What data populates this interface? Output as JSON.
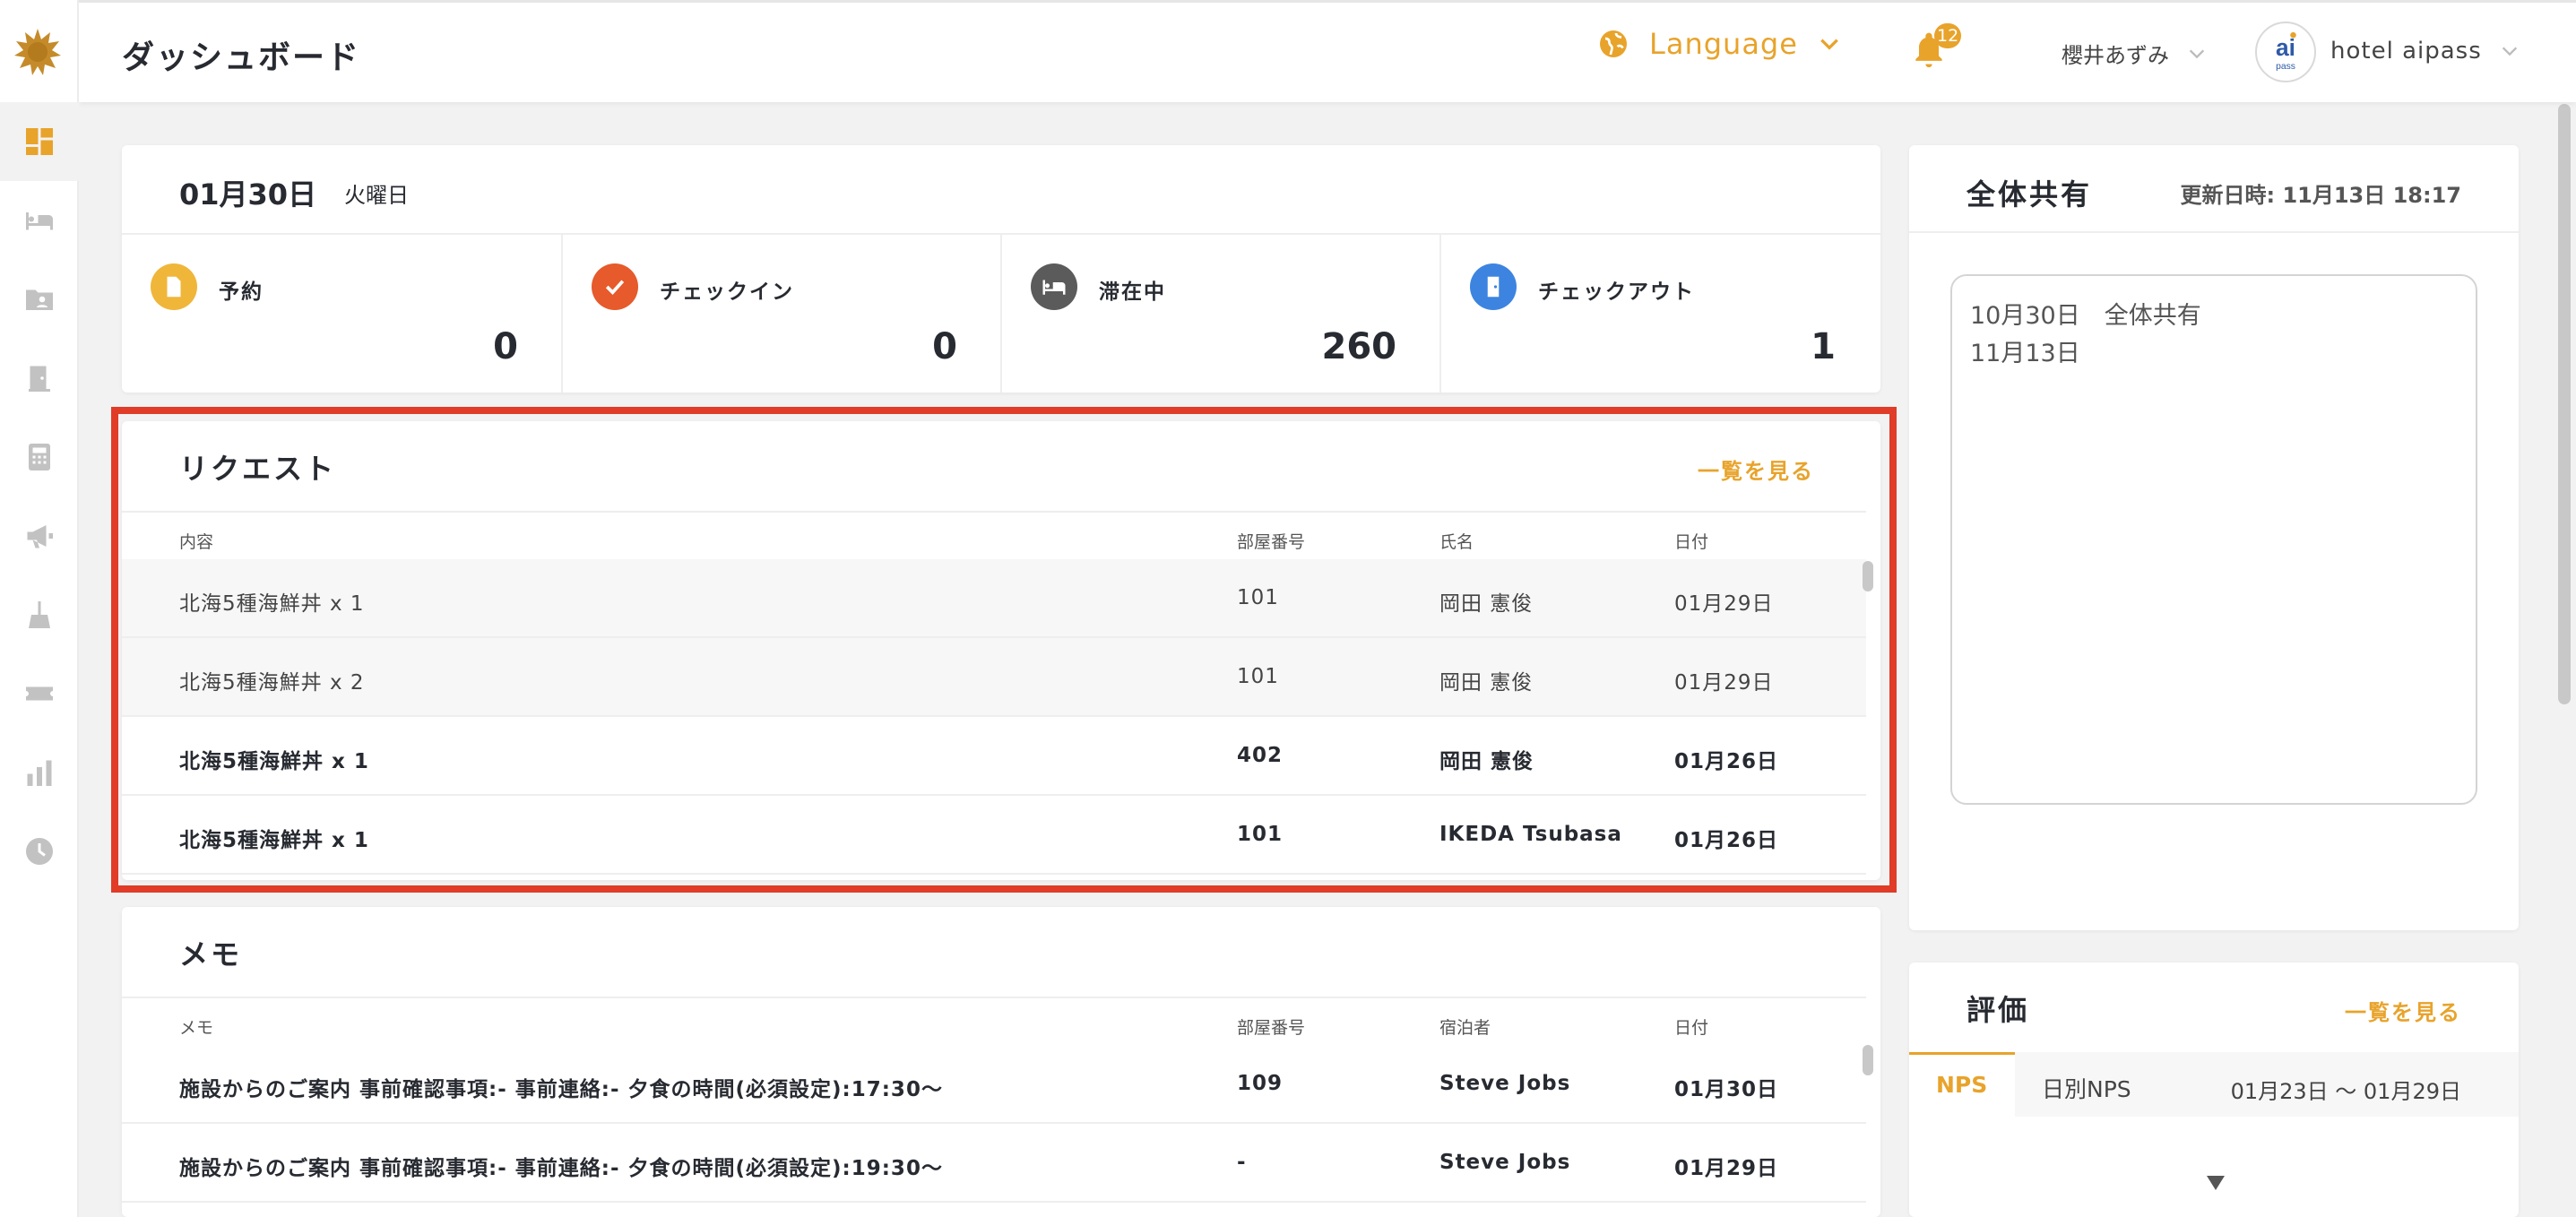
{
  "header": {
    "title": "ダッシュボード",
    "language_label": "Language",
    "notification_count": "12",
    "user_name": "櫻井あずみ",
    "hotel_name": "hotel aipass"
  },
  "sidebar": {
    "items": [
      "dashboard",
      "bed",
      "folder-user",
      "door",
      "calculator",
      "megaphone",
      "cleaning",
      "ticket",
      "bar-chart",
      "clock"
    ]
  },
  "date_summary": {
    "date": "01月30日",
    "weekday": "火曜日",
    "stats": [
      {
        "label": "予約",
        "value": "0",
        "color": "#f0b63a",
        "icon": "document-icon"
      },
      {
        "label": "チェックイン",
        "value": "0",
        "color": "#e65a2b",
        "icon": "check-icon"
      },
      {
        "label": "滞在中",
        "value": "260",
        "color": "#5b5b5b",
        "icon": "bed-icon"
      },
      {
        "label": "チェックアウト",
        "value": "1",
        "color": "#3d84e0",
        "icon": "door-icon"
      }
    ]
  },
  "requests": {
    "title": "リクエスト",
    "see_all": "一覧を見る",
    "columns": [
      "内容",
      "部屋番号",
      "氏名",
      "日付"
    ],
    "rows": [
      {
        "content": "北海5種海鮮丼 x 1",
        "room": "101",
        "name": "岡田 憲俊",
        "date": "01月29日",
        "read": true
      },
      {
        "content": "北海5種海鮮丼 x 2",
        "room": "101",
        "name": "岡田 憲俊",
        "date": "01月29日",
        "read": true
      },
      {
        "content": "北海5種海鮮丼 x 1",
        "room": "402",
        "name": "岡田 憲俊",
        "date": "01月26日",
        "read": false
      },
      {
        "content": "北海5種海鮮丼 x 1",
        "room": "101",
        "name": "IKEDA Tsubasa",
        "date": "01月26日",
        "read": false
      }
    ]
  },
  "memos": {
    "title": "メモ",
    "columns": [
      "メモ",
      "部屋番号",
      "宿泊者",
      "日付"
    ],
    "rows": [
      {
        "memo": "施設からのご案内 事前確認事項:- 事前連絡:- 夕食の時間(必須設定):17:30〜",
        "room": "109",
        "guest": "Steve Jobs",
        "date": "01月30日"
      },
      {
        "memo": "施設からのご案内 事前確認事項:- 事前連絡:- 夕食の時間(必須設定):19:30〜",
        "room": "-",
        "guest": "Steve Jobs",
        "date": "01月29日"
      }
    ]
  },
  "shared": {
    "title": "全体共有",
    "updated": "更新日時: 11月13日 18:17",
    "lines": [
      "10月30日　全体共有",
      "11月13日"
    ]
  },
  "evaluation": {
    "title": "評価",
    "see_all": "一覧を見る",
    "tabs": [
      "NPS",
      "日別NPS"
    ],
    "range": "01月23日 〜 01月29日"
  },
  "colors": {
    "accent": "#e8a32b",
    "highlight": "#e03c28"
  }
}
